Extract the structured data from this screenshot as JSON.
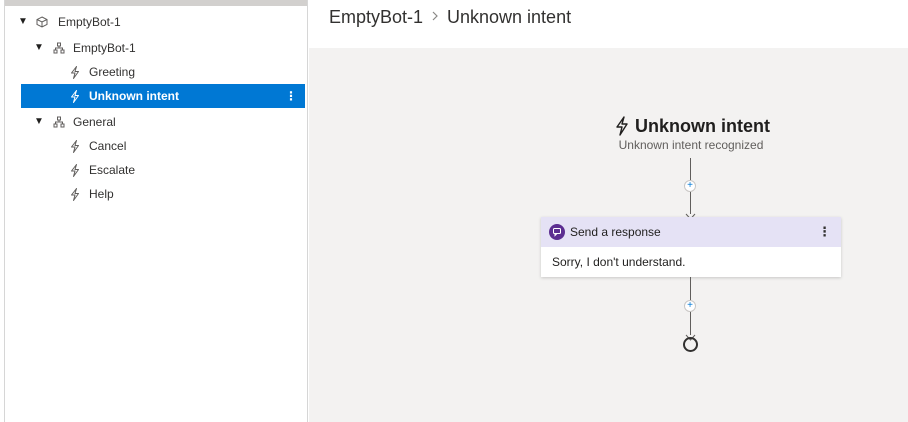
{
  "tree": {
    "root": {
      "label": "EmptyBot-1",
      "icon": "cube-icon"
    },
    "dialogs": [
      {
        "label": "EmptyBot-1",
        "icon": "dialog-tree-icon",
        "triggers": [
          {
            "label": "Greeting",
            "icon": "lightning-icon"
          },
          {
            "label": "Unknown intent",
            "icon": "lightning-icon",
            "selected": true,
            "more": "⋮"
          }
        ]
      },
      {
        "label": "General",
        "icon": "dialog-tree-icon",
        "triggers": [
          {
            "label": "Cancel",
            "icon": "lightning-icon"
          },
          {
            "label": "Escalate",
            "icon": "lightning-icon"
          },
          {
            "label": "Help",
            "icon": "lightning-icon"
          }
        ]
      }
    ]
  },
  "header": {
    "breadcrumb": [
      "EmptyBot-1",
      "Unknown intent"
    ]
  },
  "canvas": {
    "trigger_title": "Unknown intent",
    "trigger_subtitle": "Unknown intent recognized",
    "plus_label": "+",
    "action_card": {
      "title": "Send a response",
      "more": "⋮",
      "body": "Sorry, I don't understand."
    }
  },
  "colors": {
    "selection": "#0078d4",
    "card_header": "#e5e2f5",
    "card_icon": "#5c2e91",
    "canvas_bg": "#f3f2f1"
  }
}
